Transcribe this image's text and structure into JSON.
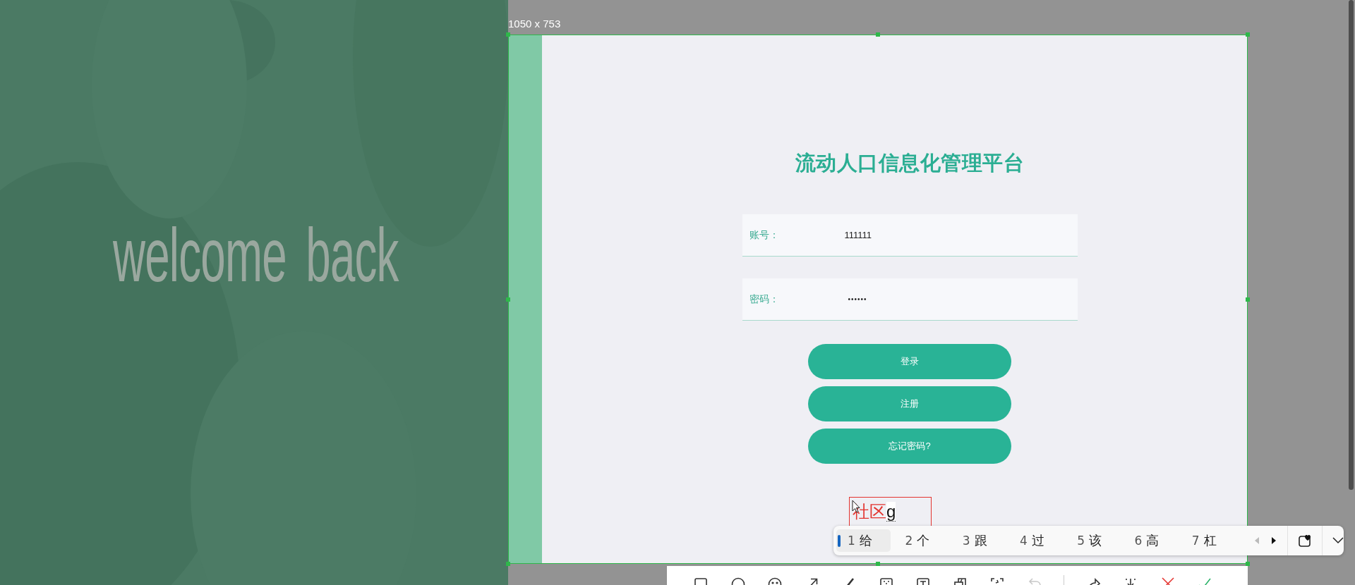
{
  "page": {
    "welcome": "welcome back",
    "title": "流动人口信息化管理平台",
    "fields": [
      {
        "label": "账号：",
        "value": "111111",
        "kind": "text"
      },
      {
        "label": "密码：",
        "value": "••••••",
        "kind": "password"
      }
    ],
    "buttons": [
      "登录",
      "注册",
      "忘记密码?"
    ]
  },
  "capture": {
    "size_label": "1050 x 753",
    "annotation": {
      "typed": "社区",
      "composing": "g"
    },
    "ime_candidates": [
      {
        "number": "1",
        "text": "给",
        "selected": true
      },
      {
        "number": "2",
        "text": "个",
        "selected": false
      },
      {
        "number": "3",
        "text": "跟",
        "selected": false
      },
      {
        "number": "4",
        "text": "过",
        "selected": false
      },
      {
        "number": "5",
        "text": "该",
        "selected": false
      },
      {
        "number": "6",
        "text": "高",
        "selected": false
      },
      {
        "number": "7",
        "text": "杠",
        "selected": false
      }
    ],
    "toolbar": [
      {
        "kind": "rectangle",
        "disabled": false
      },
      {
        "kind": "ellipse",
        "disabled": false
      },
      {
        "kind": "emoji",
        "disabled": false
      },
      {
        "kind": "arrow",
        "disabled": false
      },
      {
        "kind": "pen",
        "disabled": false
      },
      {
        "kind": "mosaic",
        "disabled": false
      },
      {
        "kind": "text",
        "disabled": false
      },
      {
        "kind": "layers",
        "disabled": false
      },
      {
        "kind": "scan",
        "disabled": false
      },
      {
        "kind": "undo",
        "disabled": true
      },
      {
        "kind": "share",
        "disabled": false
      },
      {
        "kind": "pin",
        "disabled": false
      },
      {
        "kind": "cancel",
        "disabled": false
      },
      {
        "kind": "confirm",
        "disabled": false
      }
    ]
  }
}
